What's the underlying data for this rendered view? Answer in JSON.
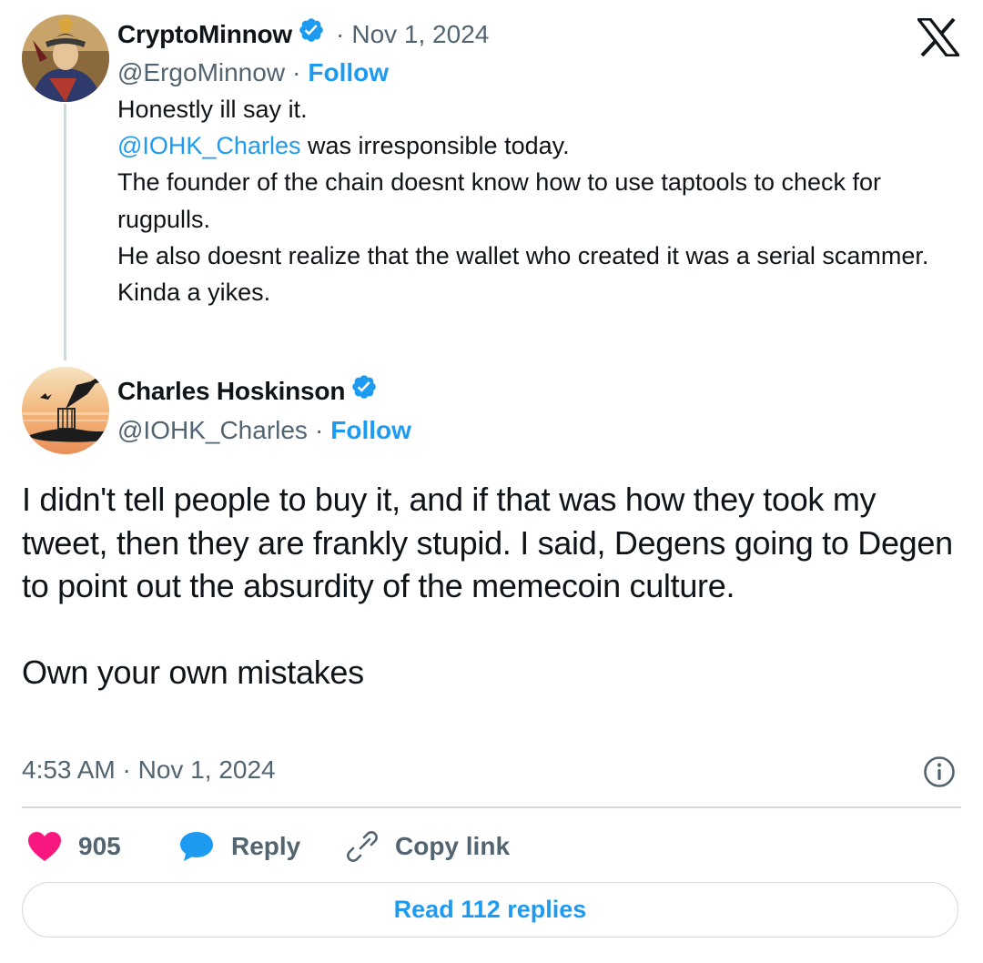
{
  "parent_tweet": {
    "author_name": "CryptoMinnow",
    "date_sep": "·",
    "date": "Nov 1, 2024",
    "handle": "@ErgoMinnow",
    "handle_sep": "·",
    "follow_label": "Follow",
    "lines": {
      "l1": "Honestly ill say it.",
      "l2_mention": "@IOHK_Charles",
      "l2_rest": " was irresponsible today.",
      "l3": "The founder of the chain doesnt know how to use taptools to check for rugpulls.",
      "l4": "He also doesnt realize that the wallet who created it was a serial scammer.",
      "l5": "Kinda a yikes."
    }
  },
  "main_tweet": {
    "author_name": "Charles Hoskinson",
    "handle": "@IOHK_Charles",
    "handle_sep": "·",
    "follow_label": "Follow",
    "paragraph_1": "I didn't tell people to buy it, and if that was how they took my tweet, then they are frankly stupid. I said, Degens going to Degen to point out the absurdity of the memecoin culture.",
    "paragraph_2": "Own your own mistakes",
    "timestamp": "4:53 AM · Nov 1, 2024"
  },
  "actions": {
    "likes_count": "905",
    "reply_label": "Reply",
    "copy_link_label": "Copy link",
    "read_replies_label": "Read 112 replies"
  },
  "icons": {
    "x_logo": "x-logo-icon",
    "verified": "verified-badge-icon",
    "info": "info-icon",
    "heart": "heart-icon",
    "reply": "reply-bubble-icon",
    "link": "link-icon"
  },
  "colors": {
    "accent": "#1d9bf0",
    "like": "#f91880",
    "text": "#0f1419",
    "muted": "#536471",
    "border": "#cfd9de"
  }
}
